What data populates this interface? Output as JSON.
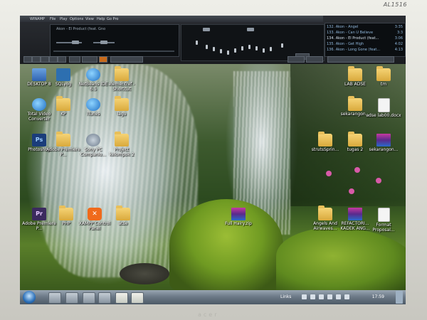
{
  "monitor": {
    "model": "AL1516",
    "brand": "acer"
  },
  "winamp": {
    "title": "WINAMP",
    "menu": [
      "File",
      "Play",
      "Options",
      "View",
      "Help",
      "Go Pro"
    ],
    "now_playing": "Akon - El Product (feat. Gno",
    "playlist": [
      {
        "title": "132. Akon - Angel",
        "time": "3:35"
      },
      {
        "title": "133. Akon - Can U Believe",
        "time": "3:3"
      },
      {
        "title": "134. Akon - El Product (feat...",
        "time": "3:06"
      },
      {
        "title": "135. Akon - Get High",
        "time": "4:02"
      },
      {
        "title": "136. Akon - Long Gone (feat...",
        "time": "4:13"
      }
    ]
  },
  "desktop": {
    "icons": [
      {
        "key": "desktop-8",
        "label": "DESKTOP 8",
        "type": "desk"
      },
      {
        "key": "sqlyog",
        "label": "SQLyog",
        "type": "sq"
      },
      {
        "key": "netbeans",
        "label": "NetBeans IDE 6.5",
        "type": "blue"
      },
      {
        "key": "element-ref",
        "label": "elementref - Shortcut",
        "type": "folder"
      },
      {
        "key": "total-video",
        "label": "Total Video Converter",
        "type": "blue"
      },
      {
        "key": "kp",
        "label": "KP",
        "type": "folder"
      },
      {
        "key": "itunes",
        "label": "iTunes",
        "type": "blue"
      },
      {
        "key": "lagu",
        "label": "lagu",
        "type": "folder"
      },
      {
        "key": "photoshop",
        "label": "Photoshop",
        "type": "ps"
      },
      {
        "key": "adobe-premiere-folder",
        "label": "Adobe Premiere P...",
        "type": "folder"
      },
      {
        "key": "sony-pc",
        "label": "Sony PC Companio...",
        "type": "gear"
      },
      {
        "key": "project",
        "label": "Project kelompok 2",
        "type": "folder"
      },
      {
        "key": "adobe-premiere",
        "label": "Adobe Premiere P...",
        "type": "pr"
      },
      {
        "key": "php",
        "label": "PHP",
        "type": "folder"
      },
      {
        "key": "xampp",
        "label": "XAMPP Control Panel",
        "type": "xampp"
      },
      {
        "key": "atse",
        "label": "atse",
        "type": "folder"
      },
      {
        "key": "lab-adse",
        "label": "LAB ADSE",
        "type": "folder"
      },
      {
        "key": "tm",
        "label": "tm",
        "type": "folder"
      },
      {
        "key": "sekarangon-1",
        "label": "sekarangon...",
        "type": "folder"
      },
      {
        "key": "adse-lab",
        "label": "adse lab00.docx",
        "type": "doc"
      },
      {
        "key": "struts",
        "label": "strutsSprin...",
        "type": "folder"
      },
      {
        "key": "tugas",
        "label": "tugas 2",
        "type": "folder"
      },
      {
        "key": "sekarangon-2",
        "label": "sekarangon...",
        "type": "rar"
      },
      {
        "key": "full-hairy",
        "label": "Full Hairy.zip",
        "type": "rar"
      },
      {
        "key": "angels",
        "label": "Angels And Airwaves...",
        "type": "folder"
      },
      {
        "key": "refactor",
        "label": "REFACTORI... KADEK ANG...",
        "type": "rar"
      },
      {
        "key": "format",
        "label": "Format Proposal...",
        "type": "doc"
      }
    ]
  },
  "taskbar": {
    "links_label": "Links",
    "clock": "17:59"
  }
}
